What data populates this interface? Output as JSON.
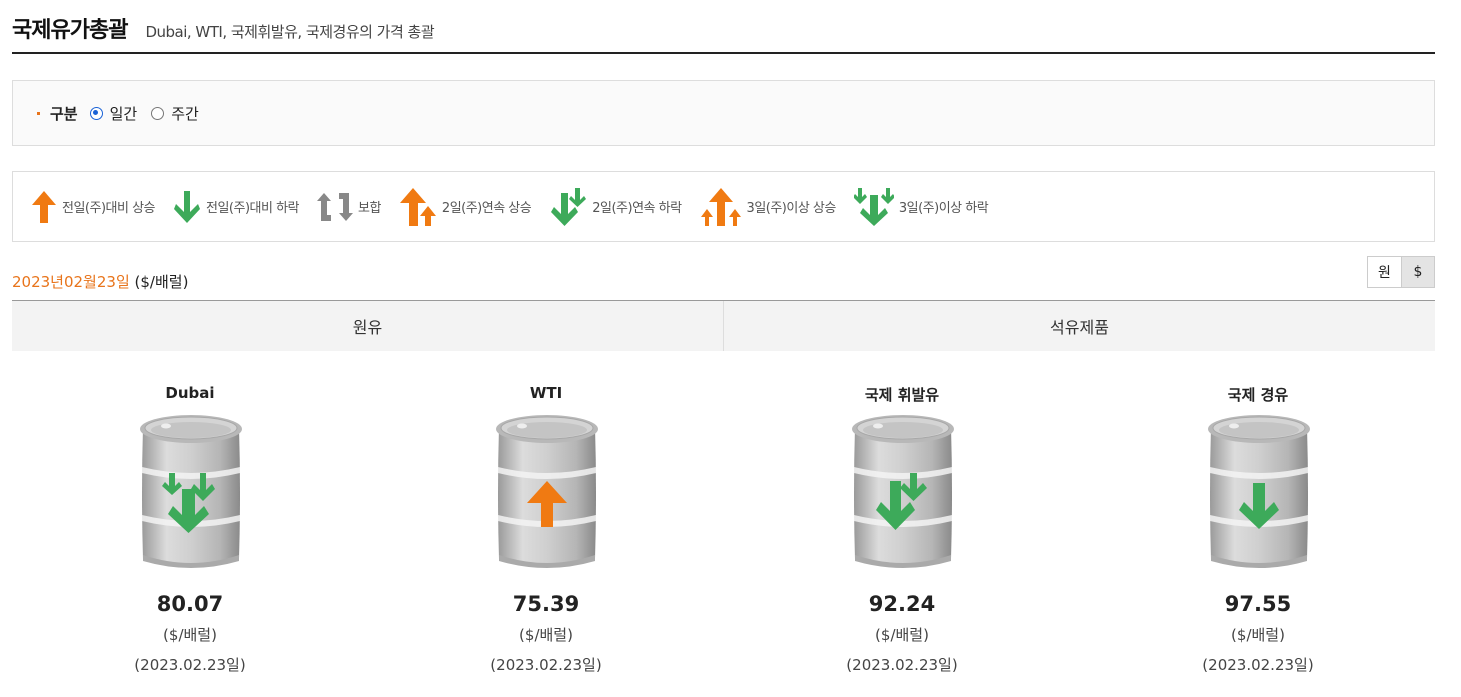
{
  "header": {
    "title": "국제유가총괄",
    "subtitle": "Dubai, WTI, 국제휘발유, 국제경유의 가격 총괄"
  },
  "filter": {
    "label": "구분",
    "options": [
      {
        "label": "일간",
        "checked": true
      },
      {
        "label": "주간",
        "checked": false
      }
    ]
  },
  "legend": [
    {
      "label": "전일(주)대비 상승",
      "icon": "up-arrow-icon"
    },
    {
      "label": "전일(주)대비 하락",
      "icon": "down-arrow-icon"
    },
    {
      "label": "보합",
      "icon": "flat-arrows-icon"
    },
    {
      "label": "2일(주)연속 상승",
      "icon": "double-up-arrow-icon"
    },
    {
      "label": "2일(주)연속 하락",
      "icon": "double-down-arrow-icon"
    },
    {
      "label": "3일(주)이상 상승",
      "icon": "triple-up-arrow-icon"
    },
    {
      "label": "3일(주)이상 하락",
      "icon": "triple-down-arrow-icon"
    }
  ],
  "date": {
    "value": "2023년02월23일",
    "unit": "($/배럴)"
  },
  "unit_toggle": {
    "won": "원",
    "dollar": "$",
    "active": "dollar"
  },
  "tabs": [
    {
      "label": "원유"
    },
    {
      "label": "석유제품"
    }
  ],
  "items": [
    {
      "name": "Dubai",
      "value": "80.07",
      "unit": "($/배럴)",
      "date": "(2023.02.23일)",
      "trend": "triple-down"
    },
    {
      "name": "WTI",
      "value": "75.39",
      "unit": "($/배럴)",
      "date": "(2023.02.23일)",
      "trend": "up"
    },
    {
      "name": "국제 휘발유",
      "value": "92.24",
      "unit": "($/배럴)",
      "date": "(2023.02.23일)",
      "trend": "double-down"
    },
    {
      "name": "국제 경유",
      "value": "97.55",
      "unit": "($/배럴)",
      "date": "(2023.02.23일)",
      "trend": "down"
    }
  ],
  "colors": {
    "accent_orange": "#e8741b",
    "up_arrow": "#f07a12",
    "down_arrow": "#3daa5a",
    "flat_arrow": "#888888",
    "radio_checked": "#1a62d6"
  }
}
